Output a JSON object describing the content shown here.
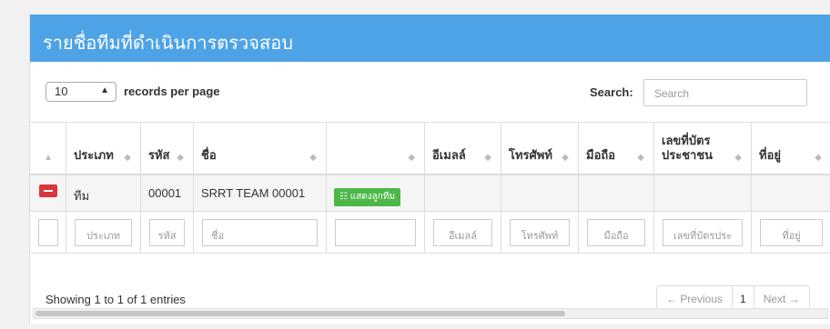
{
  "panel": {
    "title": "รายชื่อทีมที่ดำเนินการตรวจสอบ"
  },
  "controls": {
    "length_value": "10",
    "records_per_page": "records per page",
    "search_label": "Search:",
    "search_placeholder": "Search"
  },
  "table": {
    "columns": [
      {
        "label": ""
      },
      {
        "label": "ประเภท"
      },
      {
        "label": "รหัส"
      },
      {
        "label": "ชื่อ"
      },
      {
        "label": ""
      },
      {
        "label": "อีเมลล์"
      },
      {
        "label": "โทรศัพท์"
      },
      {
        "label": "มือถือ"
      },
      {
        "label": "เลขที่บัตร\nประชาชน"
      },
      {
        "label": "ที่อยู่"
      }
    ],
    "row": {
      "type": "ทีม",
      "code": "00001",
      "name": "SRRT TEAM 00001",
      "action_label": "แสดงลูกทีม"
    },
    "filters": [
      "ประเภท",
      "รหัส",
      "ชื่อ",
      "",
      "อีเมลล์",
      "โทรศัพท์",
      "มือถือ",
      "เลขที่บัตรประ",
      "ที่อยู่"
    ]
  },
  "footer": {
    "info": "Showing 1 to 1 of 1 entries",
    "prev": "← Previous",
    "page": "1",
    "next": "Next →"
  },
  "colors": {
    "header": "#4ea3e6",
    "danger": "#d9363e",
    "success": "#4cb848"
  }
}
